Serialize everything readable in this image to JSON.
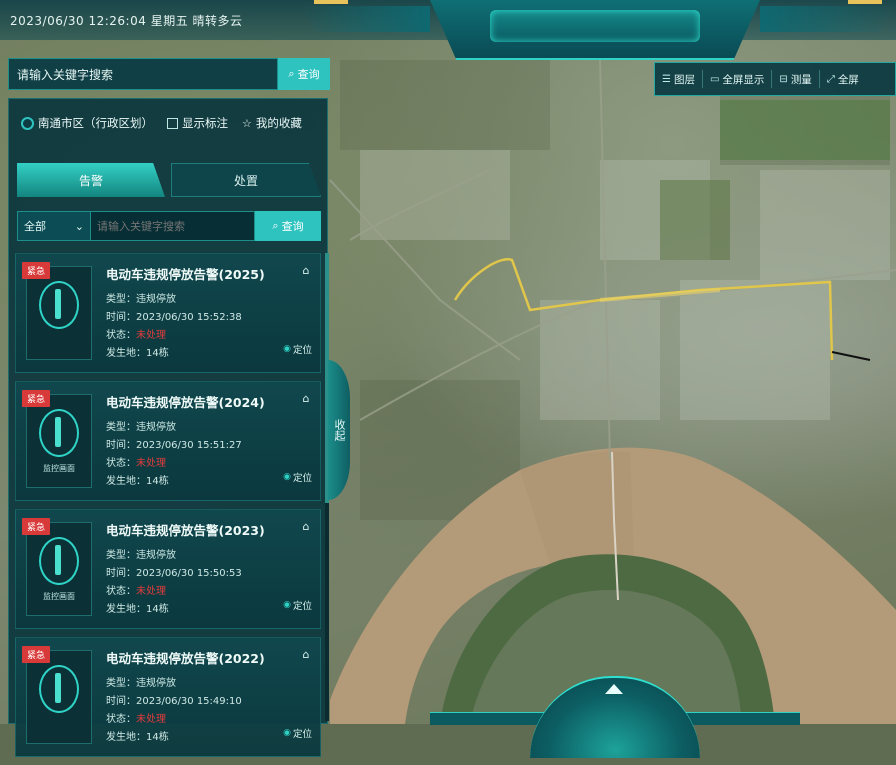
{
  "header": {
    "datetime": "2023/06/30 12:26:04  星期五  晴转多云"
  },
  "toolbar": {
    "items": [
      {
        "icon": "layers-icon",
        "label": "图层"
      },
      {
        "icon": "monitor-icon",
        "label": "全屏显示"
      },
      {
        "icon": "ruler-icon",
        "label": "测量"
      },
      {
        "icon": "fullscreen-icon",
        "label": "全屏"
      }
    ]
  },
  "search": {
    "value": "请输入关键字搜索",
    "button_label": "查询"
  },
  "filters": {
    "radio_label": "南通市区（行政区划）",
    "check_label": "显示标注",
    "star_label": "我的收藏"
  },
  "tabs": {
    "active_label": "告警",
    "inactive_label": "处置"
  },
  "query": {
    "select_value": "全部",
    "keyword_placeholder": "请输入关键字搜索",
    "button_label": "查询"
  },
  "cards": [
    {
      "badge": "紧急",
      "title": "电动车违规停放告警(2025)",
      "type": "类型：违规停放",
      "time": "时间：2023/06/30 15:52:38",
      "status_prefix": "状态：",
      "status": "未处理",
      "place": "发生地：14栋",
      "thumb_label": "",
      "locate": "定位"
    },
    {
      "badge": "紧急",
      "title": "电动车违规停放告警(2024)",
      "type": "类型：违规停放",
      "time": "时间：2023/06/30 15:51:27",
      "status_prefix": "状态：",
      "status": "未处理",
      "place": "发生地：14栋",
      "thumb_label": "监控画面",
      "locate": "定位"
    },
    {
      "badge": "紧急",
      "title": "电动车违规停放告警(2023)",
      "type": "类型：违规停放",
      "time": "时间：2023/06/30 15:50:53",
      "status_prefix": "状态：",
      "status": "未处理",
      "place": "发生地：14栋",
      "thumb_label": "监控画面",
      "locate": "定位"
    },
    {
      "badge": "紧急",
      "title": "电动车违规停放告警(2022)",
      "type": "类型：违规停放",
      "time": "时间：2023/06/30 15:49:10",
      "status_prefix": "状态：",
      "status": "未处理",
      "place": "发生地：14栋",
      "thumb_label": "",
      "locate": "定位"
    }
  ],
  "collapse_label": "收起",
  "colors": {
    "accent": "#2fc3c0",
    "panel": "#0c373e",
    "badge": "#d83a3a",
    "route": "#e0c64a"
  }
}
